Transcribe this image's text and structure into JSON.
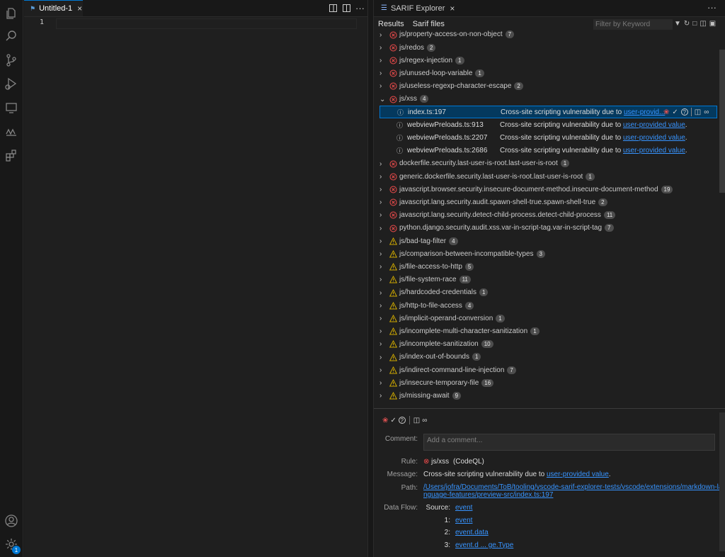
{
  "editor": {
    "tab_title": "Untitled-1",
    "line_number": "1"
  },
  "panel": {
    "tab_title": "SARIF Explorer",
    "subtabs": [
      "Results",
      "Sarif files"
    ],
    "filter_placeholder": "Filter by Keyword"
  },
  "tree": {
    "rules_before": [
      {
        "name": "js/property-access-on-non-object",
        "count": "7",
        "severity": "error"
      },
      {
        "name": "js/redos",
        "count": "2",
        "severity": "error"
      },
      {
        "name": "js/regex-injection",
        "count": "1",
        "severity": "error"
      },
      {
        "name": "js/unused-loop-variable",
        "count": "1",
        "severity": "error"
      },
      {
        "name": "js/useless-regexp-character-escape",
        "count": "2",
        "severity": "error"
      },
      {
        "name": "js/xss",
        "count": "4",
        "severity": "error",
        "expanded": true
      }
    ],
    "results": [
      {
        "file": "index.ts:197",
        "msg": "Cross-site scripting vulnerability due to ",
        "link": "user-provid...",
        "suffix": ""
      },
      {
        "file": "webviewPreloads.ts:913",
        "msg": "Cross-site scripting vulnerability due to ",
        "link": "user-provided value",
        "suffix": "."
      },
      {
        "file": "webviewPreloads.ts:2207",
        "msg": "Cross-site scripting vulnerability due to ",
        "link": "user-provided value",
        "suffix": "."
      },
      {
        "file": "webviewPreloads.ts:2686",
        "msg": "Cross-site scripting vulnerability due to ",
        "link": "user-provided value",
        "suffix": "."
      }
    ],
    "rules_after": [
      {
        "name": "dockerfile.security.last-user-is-root.last-user-is-root",
        "count": "1",
        "severity": "error"
      },
      {
        "name": "generic.dockerfile.security.last-user-is-root.last-user-is-root",
        "count": "1",
        "severity": "error"
      },
      {
        "name": "javascript.browser.security.insecure-document-method.insecure-document-method",
        "count": "19",
        "severity": "error"
      },
      {
        "name": "javascript.lang.security.audit.spawn-shell-true.spawn-shell-true",
        "count": "2",
        "severity": "error"
      },
      {
        "name": "javascript.lang.security.detect-child-process.detect-child-process",
        "count": "11",
        "severity": "error"
      },
      {
        "name": "python.django.security.audit.xss.var-in-script-tag.var-in-script-tag",
        "count": "7",
        "severity": "error"
      },
      {
        "name": "js/bad-tag-filter",
        "count": "4",
        "severity": "warning"
      },
      {
        "name": "js/comparison-between-incompatible-types",
        "count": "3",
        "severity": "warning"
      },
      {
        "name": "js/file-access-to-http",
        "count": "5",
        "severity": "warning"
      },
      {
        "name": "js/file-system-race",
        "count": "11",
        "severity": "warning"
      },
      {
        "name": "js/hardcoded-credentials",
        "count": "1",
        "severity": "warning"
      },
      {
        "name": "js/http-to-file-access",
        "count": "4",
        "severity": "warning"
      },
      {
        "name": "js/implicit-operand-conversion",
        "count": "1",
        "severity": "warning"
      },
      {
        "name": "js/incomplete-multi-character-sanitization",
        "count": "1",
        "severity": "warning"
      },
      {
        "name": "js/incomplete-sanitization",
        "count": "10",
        "severity": "warning"
      },
      {
        "name": "js/index-out-of-bounds",
        "count": "1",
        "severity": "warning"
      },
      {
        "name": "js/indirect-command-line-injection",
        "count": "7",
        "severity": "warning"
      },
      {
        "name": "js/insecure-temporary-file",
        "count": "16",
        "severity": "warning"
      },
      {
        "name": "js/missing-await",
        "count": "9",
        "severity": "warning"
      }
    ]
  },
  "detail": {
    "comment_label": "Comment:",
    "comment_placeholder": "Add a comment...",
    "rule_label": "Rule:",
    "rule_value": "js/xss",
    "rule_tool": "(CodeQL)",
    "message_label": "Message:",
    "message_text": "Cross-site scripting vulnerability due to ",
    "message_link": "user-provided value",
    "message_suffix": ".",
    "path_label": "Path:",
    "path_line1": "/Users/jofra/Documents/ToB/tooling/vscode-sarif-explorer-tests/vscode/extensions/markdown-la",
    "path_line2": "nguage-features/preview-src/index.ts:197",
    "dataflow_label": "Data Flow:",
    "flow": [
      {
        "key": "Source:",
        "value": "event"
      },
      {
        "key": "1:",
        "value": "event"
      },
      {
        "key": "2:",
        "value": "event.data"
      },
      {
        "key": "3:",
        "value": "event.d ... ge.Type"
      }
    ]
  },
  "colors": {
    "error": "#f14c4c",
    "warning": "#cca700",
    "link": "#3794ff",
    "accent": "#0078d4"
  },
  "activity_badge": "1"
}
